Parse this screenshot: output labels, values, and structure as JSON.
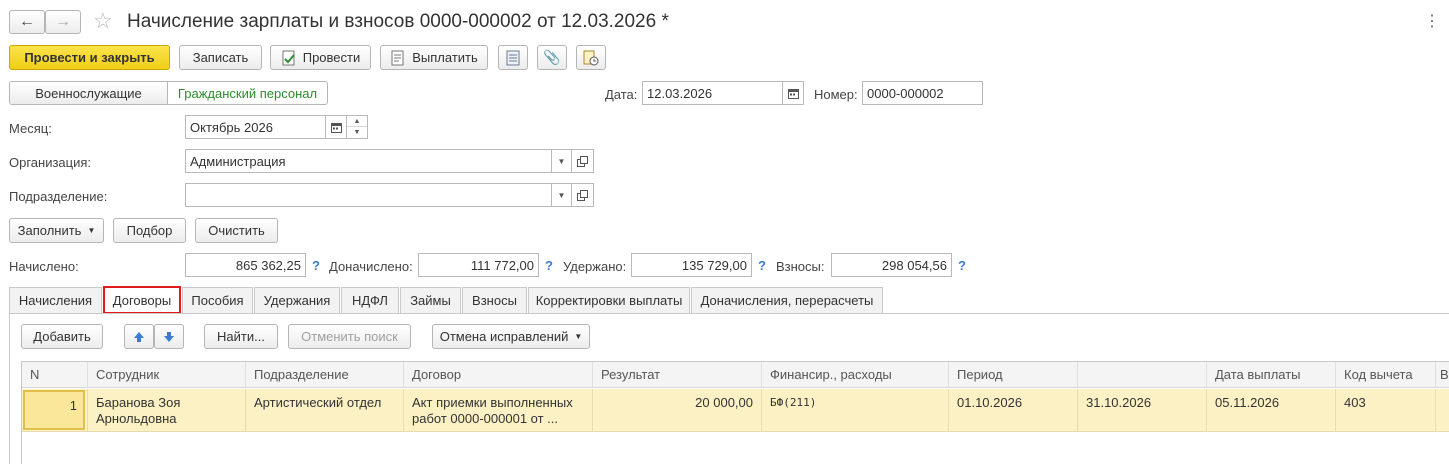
{
  "window": {
    "title": "Начисление зарплаты и взносов 0000-000002 от 12.03.2026 *"
  },
  "toolbar": {
    "post_close_label": "Провести и закрыть",
    "write_label": "Записать",
    "post_label": "Провести",
    "pay_label": "Выплатить"
  },
  "mode_switch": {
    "military_label": "Военнослужащие",
    "civilian_label": "Гражданский персонал"
  },
  "header_fields": {
    "date_label": "Дата:",
    "date_value": "12.03.2026",
    "number_label": "Номер:",
    "number_value": "0000-000002"
  },
  "form": {
    "month_label": "Месяц:",
    "month_value": "Октябрь 2026",
    "org_label": "Организация:",
    "org_value": "Администрация",
    "dept_label": "Подразделение:",
    "dept_value": ""
  },
  "actions": {
    "fill_label": "Заполнить",
    "pick_label": "Подбор",
    "clear_label": "Очистить"
  },
  "totals": {
    "accrued_label": "Начислено:",
    "accrued_value": "865 362,25",
    "extra_label": "Доначислено:",
    "extra_value": "111 772,00",
    "withheld_label": "Удержано:",
    "withheld_value": "135 729,00",
    "contrib_label": "Взносы:",
    "contrib_value": "298 054,56",
    "help": "?"
  },
  "tabs": [
    {
      "label": "Начисления"
    },
    {
      "label": "Договоры"
    },
    {
      "label": "Пособия"
    },
    {
      "label": "Удержания"
    },
    {
      "label": "НДФЛ"
    },
    {
      "label": "Займы"
    },
    {
      "label": "Взносы"
    },
    {
      "label": "Корректировки выплаты"
    },
    {
      "label": "Доначисления, перерасчеты"
    }
  ],
  "table_toolbar": {
    "add_label": "Добавить",
    "find_label": "Найти...",
    "cancel_search_label": "Отменить поиск",
    "cancel_fix_label": "Отмена исправлений"
  },
  "table": {
    "columns": [
      "N",
      "Сотрудник",
      "Подразделение",
      "Договор",
      "Результат",
      "Финансир., расходы",
      "Период",
      "",
      "Дата выплаты",
      "Код вычета",
      "В"
    ],
    "rows": [
      {
        "n": "1",
        "employee": "Баранова Зоя Арнольдовна",
        "department": "Артистический отдел",
        "contract": "Акт приемки выполненных работ 0000-000001 от ...",
        "result": "20 000,00",
        "financing": "БФ(211)",
        "period_start": "01.10.2026",
        "period_end": "31.10.2026",
        "pay_date": "05.11.2026",
        "deduction_code": "403"
      }
    ]
  }
}
